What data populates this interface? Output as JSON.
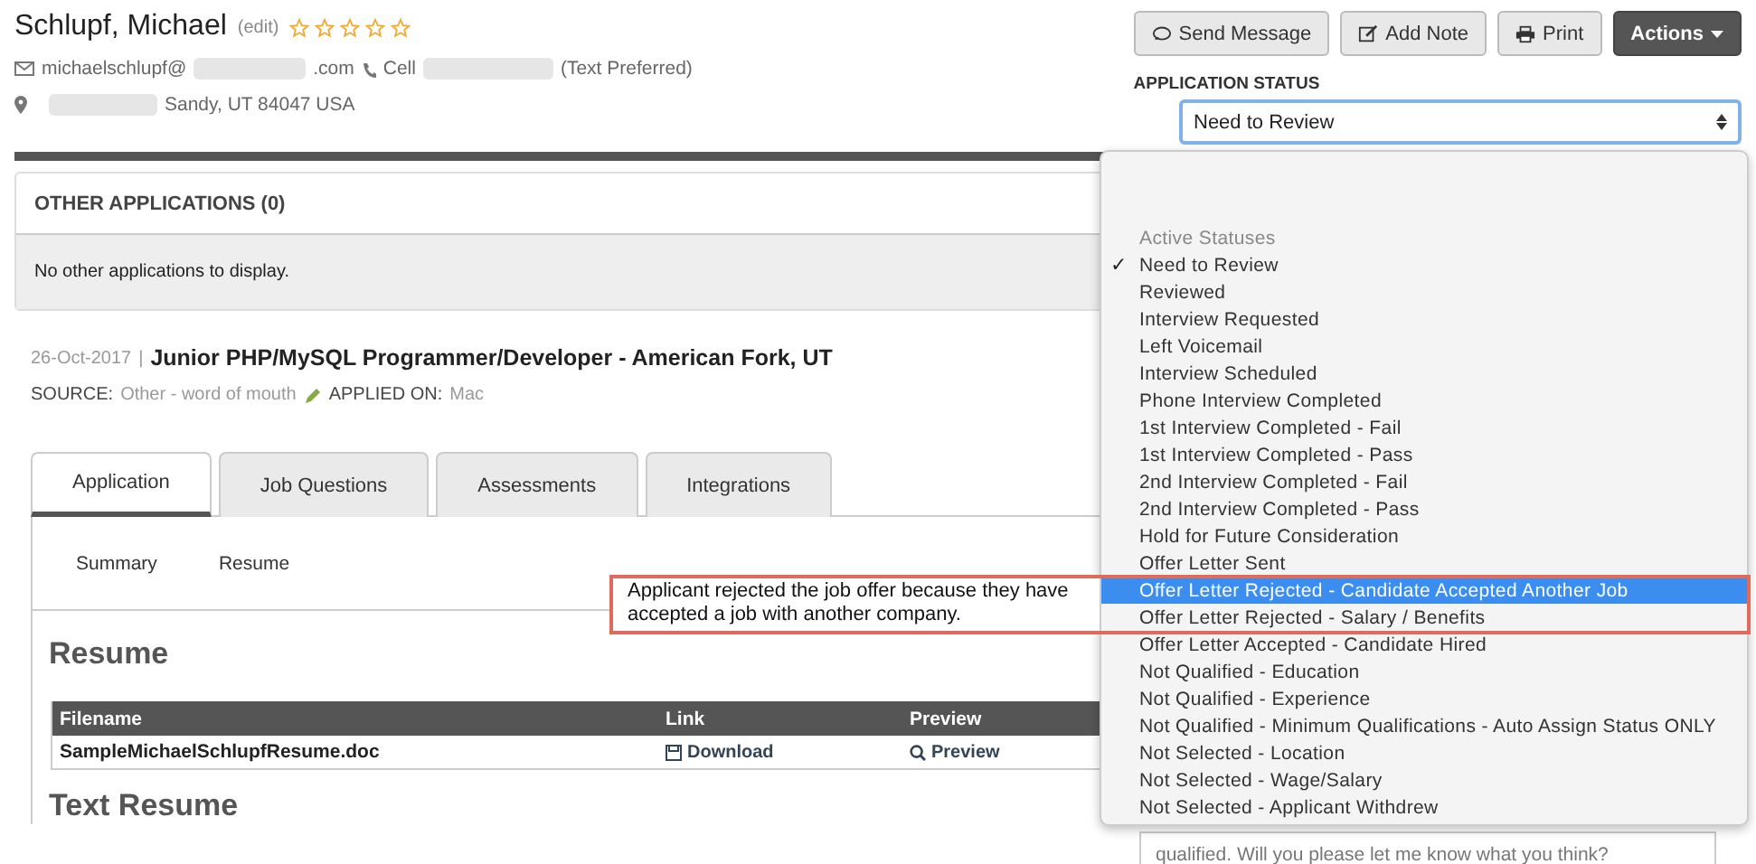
{
  "candidate": {
    "name": "Schlupf, Michael",
    "edit_link": "(edit)",
    "stars": 0,
    "email_start": "michaelschlupf@",
    "email_end": ".com",
    "phone_label": "Cell",
    "phone_note": "(Text Preferred)",
    "address": "Sandy, UT 84047 USA"
  },
  "actions": [
    {
      "label": "Send Message",
      "kind": "message"
    },
    {
      "label": "Add Note",
      "kind": "note"
    },
    {
      "label": "Print",
      "kind": "print"
    },
    {
      "label": "Actions",
      "kind": "menu"
    }
  ],
  "application_status": {
    "label": "APPLICATION STATUS",
    "value": "Need to Review"
  },
  "other_applications": {
    "title": "OTHER APPLICATIONS (0)",
    "message": "No other applications to display."
  },
  "job": {
    "date": "26-Oct-2017",
    "separator": "|",
    "title": "Junior PHP/MySQL Programmer/Developer - American Fork, UT",
    "source_label": "SOURCE:",
    "source": "Other - word of mouth",
    "applied_label": "APPLIED ON:",
    "applied": "Mac"
  },
  "tabs": [
    {
      "label": "Application",
      "selected": true
    },
    {
      "label": "Job Questions",
      "selected": false
    },
    {
      "label": "Assessments",
      "selected": false
    },
    {
      "label": "Integrations",
      "selected": false
    }
  ],
  "subtabs": [
    "Summary",
    "Resume"
  ],
  "resume": {
    "heading": "Resume",
    "columns": [
      "Filename",
      "Link",
      "Preview"
    ],
    "rows": [
      {
        "filename": "SampleMichaelSchlupfResume.doc",
        "link": "Download",
        "preview": "Preview"
      }
    ],
    "text_heading": "Text Resume"
  },
  "check_mark": "✓",
  "note_fragment": "qualified. Will you please let me know what you think?",
  "status_menu": [
    {
      "kind": "header",
      "label": "Active Statuses"
    },
    {
      "kind": "option",
      "label": "Need to Review",
      "selected": true,
      "highlighted": false
    },
    {
      "kind": "option",
      "label": "Reviewed",
      "selected": false,
      "highlighted": false
    },
    {
      "kind": "option",
      "label": "Interview Requested",
      "selected": false,
      "highlighted": false
    },
    {
      "kind": "option",
      "label": "Left Voicemail",
      "selected": false,
      "highlighted": false
    },
    {
      "kind": "option",
      "label": "Interview Scheduled",
      "selected": false,
      "highlighted": false
    },
    {
      "kind": "option",
      "label": "Phone Interview Completed",
      "selected": false,
      "highlighted": false
    },
    {
      "kind": "option",
      "label": "1st Interview Completed - Fail",
      "selected": false,
      "highlighted": false
    },
    {
      "kind": "option",
      "label": "1st Interview Completed - Pass",
      "selected": false,
      "highlighted": false
    },
    {
      "kind": "option",
      "label": "2nd Interview Completed - Fail",
      "selected": false,
      "highlighted": false
    },
    {
      "kind": "option",
      "label": "2nd Interview Completed - Pass",
      "selected": false,
      "highlighted": false
    },
    {
      "kind": "option",
      "label": "Hold for Future Consideration",
      "selected": false,
      "highlighted": false
    },
    {
      "kind": "option",
      "label": "Offer Letter Sent",
      "selected": false,
      "highlighted": false
    },
    {
      "kind": "option",
      "label": "Offer Letter Rejected - Candidate Accepted Another Job",
      "selected": false,
      "highlighted": true
    },
    {
      "kind": "option",
      "label": "Offer Letter Rejected - Salary / Benefits",
      "selected": false,
      "highlighted": false
    },
    {
      "kind": "option",
      "label": "Offer Letter Accepted - Candidate Hired",
      "selected": false,
      "highlighted": false
    },
    {
      "kind": "option",
      "label": "Not Qualified - Education",
      "selected": false,
      "highlighted": false
    },
    {
      "kind": "option",
      "label": "Not Qualified - Experience",
      "selected": false,
      "highlighted": false
    },
    {
      "kind": "option",
      "label": "Not Qualified - Minimum Qualifications - Auto Assign Status ONLY",
      "selected": false,
      "highlighted": false
    },
    {
      "kind": "option",
      "label": "Not Selected - Location",
      "selected": false,
      "highlighted": false
    },
    {
      "kind": "option",
      "label": "Not Selected - Wage/Salary",
      "selected": false,
      "highlighted": false
    },
    {
      "kind": "option",
      "label": "Not Selected - Applicant Withdrew",
      "selected": false,
      "highlighted": false
    }
  ],
  "annotation": {
    "text": "Applicant rejected the job offer because they have accepted a job with another company."
  }
}
